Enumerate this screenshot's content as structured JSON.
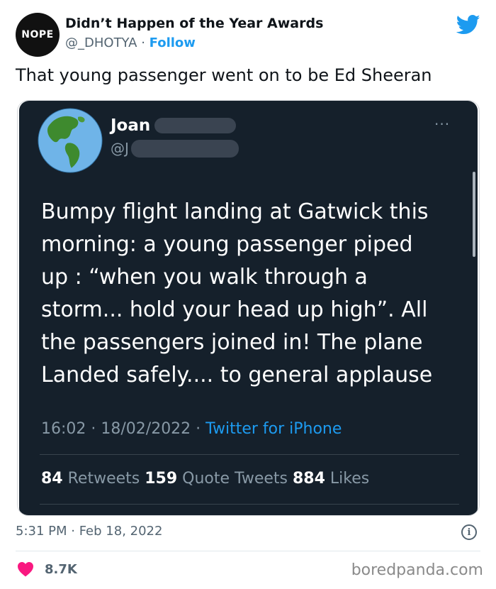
{
  "author": {
    "avatar_text": "NOPE",
    "name": "Didn’t Happen of the Year Awards",
    "handle": "@_DHOTYA",
    "separator": " · ",
    "follow_label": "Follow"
  },
  "tweet": {
    "text": "That young passenger went on to be Ed Sheeran",
    "timestamp": "5:31 PM · Feb 18, 2022",
    "like_count": "8.7K"
  },
  "embedded": {
    "name": "Joan",
    "handle": "@J",
    "more": "···",
    "lines": [
      "Bumpy flight landing at Gatwick this",
      "morning:  a young passenger piped",
      "up   : “when you walk through a",
      "storm... hold your head up high”. All",
      "the passengers joined in!  The plane",
      "Landed safely.... to general applause"
    ],
    "time_date": "16:02 · 18/02/2022 · ",
    "source": "Twitter for iPhone",
    "retweets_count": "84",
    "retweets_label": " Retweets ",
    "quotes_count": "159",
    "quotes_label": " Quote Tweets ",
    "likes_count": "884",
    "likes_label": " Likes"
  },
  "icons": {
    "twitter": "twitter-bird-icon",
    "info": "info-icon",
    "heart": "heart-icon",
    "globe": "globe-icon"
  },
  "info_glyph": "i",
  "watermark": "boredpanda.com",
  "colors": {
    "accent": "#1d9bf0",
    "heart": "#f91880",
    "dark_bg": "#15202b"
  }
}
